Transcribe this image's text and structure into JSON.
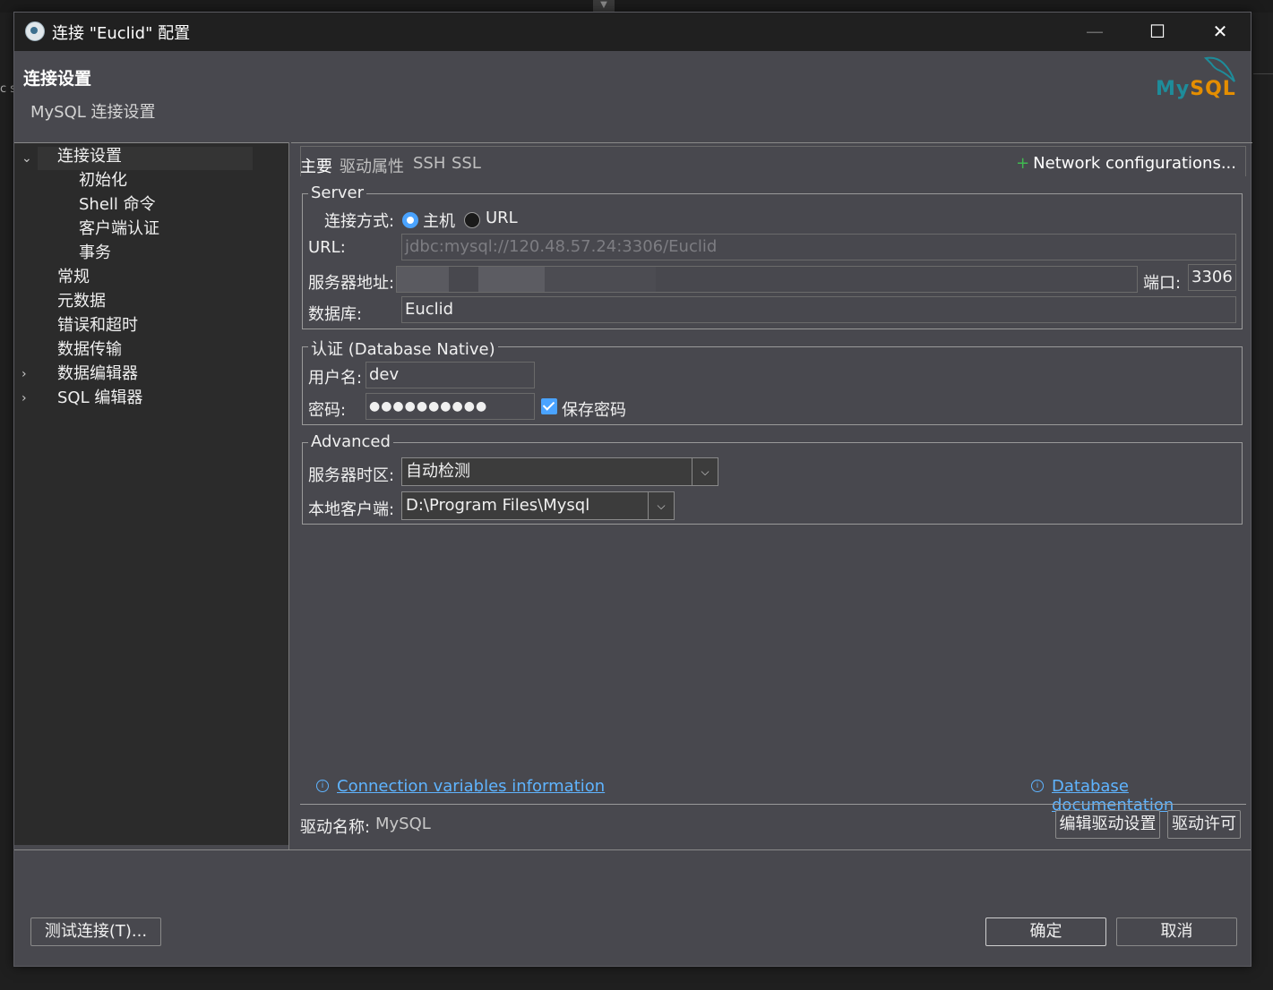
{
  "window": {
    "title": "连接 \"Euclid\" 配置",
    "minimize_glyph": "—",
    "maximize_glyph": "☐",
    "close_glyph": "✕"
  },
  "header": {
    "title": "连接设置",
    "subtitle": "MySQL 连接设置",
    "logo_text_a": "My",
    "logo_text_b": "SQL"
  },
  "tree": {
    "items": [
      {
        "label": "连接设置",
        "level": 0,
        "expanded": true
      },
      {
        "label": "初始化",
        "level": 1
      },
      {
        "label": "Shell 命令",
        "level": 1
      },
      {
        "label": "客户端认证",
        "level": 1
      },
      {
        "label": "事务",
        "level": 1
      },
      {
        "label": "常规",
        "level": 0
      },
      {
        "label": "元数据",
        "level": 0
      },
      {
        "label": "错误和超时",
        "level": 0
      },
      {
        "label": "数据传输",
        "level": 0
      },
      {
        "label": "数据编辑器",
        "level": 0,
        "collapsed": true
      },
      {
        "label": "SQL 编辑器",
        "level": 0,
        "collapsed": true
      }
    ]
  },
  "tabs": {
    "main": "主要",
    "driver_props": "驱动属性",
    "ssh": "SSH",
    "ssl": "SSL",
    "network": "Network configurations..."
  },
  "server": {
    "legend": "Server",
    "connect_by_label": "连接方式:",
    "option_host": "主机",
    "option_url": "URL",
    "url_label": "URL:",
    "url_value": "jdbc:mysql://120.48.57.24:3306/Euclid",
    "host_label": "服务器地址:",
    "host_value": "",
    "port_label": "端口:",
    "port_value": "3306",
    "db_label": "数据库:",
    "db_value": "Euclid"
  },
  "auth": {
    "legend": "认证 (Database Native)",
    "user_label": "用户名:",
    "user_value": "dev",
    "password_label": "密码:",
    "password_value": "●●●●●●●●●●",
    "save_password_label": "保存密码"
  },
  "advanced": {
    "legend": "Advanced",
    "timezone_label": "服务器时区:",
    "timezone_value": "自动检测",
    "client_label": "本地客户端:",
    "client_value": "D:\\Program Files\\Mysql"
  },
  "links": {
    "conn_vars": "Connection variables information",
    "db_docs": "Database documentation"
  },
  "driver": {
    "name_label": "驱动名称:",
    "name_value": "MySQL",
    "edit_button": "编辑驱动设置",
    "license_button": "驱动许可"
  },
  "footer": {
    "test_button": "测试连接(T)...",
    "ok_button": "确定",
    "cancel_button": "取消"
  },
  "colors": {
    "accent": "#4aa3ff",
    "link": "#5fb4ff",
    "dialog_bg": "#48484e",
    "tree_bg": "#2b2b2b",
    "plus_green": "#3fb950"
  }
}
